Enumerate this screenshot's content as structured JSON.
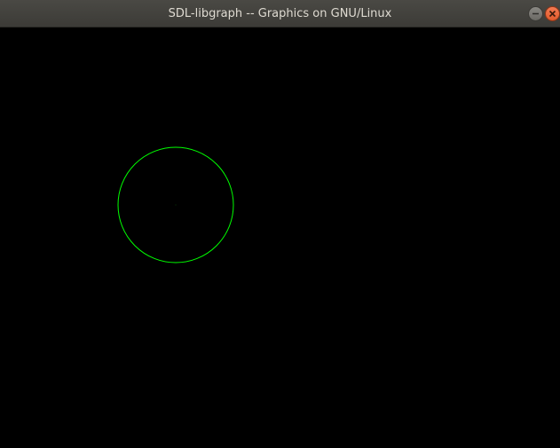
{
  "window": {
    "title": "SDL-libgraph -- Graphics on GNU/Linux"
  },
  "icons": {
    "minimize": "minimize-icon",
    "close": "close-icon"
  },
  "colors": {
    "titlebar": "#3c3b37",
    "title_text": "#dfdbd2",
    "close_button": "#e05a2b",
    "canvas_background": "#000000",
    "circle_stroke": "#00ff00"
  }
}
